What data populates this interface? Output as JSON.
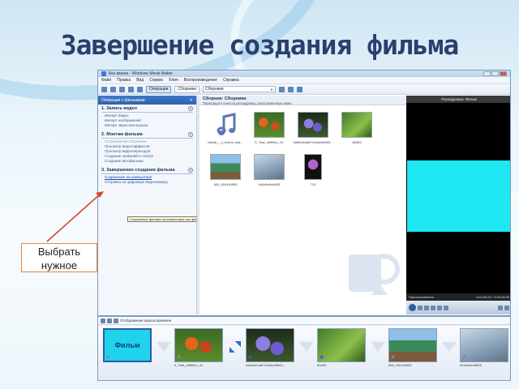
{
  "slide": {
    "title": "Завершение создания фильма",
    "callout": "Выбрать нужное"
  },
  "window": {
    "title": "Без имени - Windows Movie Maker",
    "menu": [
      "Файл",
      "Правка",
      "Вид",
      "Сервис",
      "Клип",
      "Воспроизведение",
      "Справка"
    ],
    "toolbar": {
      "tasks_button": "Операции",
      "collections_button": "Сборники",
      "collection_select": "Сборники"
    }
  },
  "tasks": {
    "header": "Операции с фильмами",
    "sections": [
      {
        "title": "1. Запись видео",
        "links": [
          "Импорт видео",
          "Импорт изображений",
          "Импорт звука или музыки"
        ]
      },
      {
        "title": "2. Монтаж фильма",
        "links": [
          "Отображение сборников",
          "Просмотр видеоэффектов",
          "Просмотр видеопереходов",
          "Создание названий и титров",
          "Создание автофильма"
        ]
      },
      {
        "title": "3. Завершение создания фильма",
        "links": [
          "Сохранение на компьютере",
          "Отправка на цифровую видеокамеру"
        ]
      }
    ],
    "tooltip": "Сохранение фильма на компьютере как файла видео."
  },
  "collection": {
    "title": "Сборник: Сборники",
    "subtitle": "Перетащите клип на раскадровку, расположенную ниже.",
    "items": [
      {
        "caption": "rivka8_-_o_bozhe_kak...",
        "kind": "music"
      },
      {
        "caption": "0_7baf_c6f99ec_XL",
        "kind": "flowers-red"
      },
      {
        "caption": "0a0b0d1afb74184ed9b53...",
        "kind": "flowers-purple"
      },
      {
        "caption": "60453",
        "kind": "green"
      },
      {
        "caption": "600_41b116953",
        "kind": "house"
      },
      {
        "caption": "644a9a1eb625",
        "kind": "sea"
      },
      {
        "caption": "713",
        "kind": "flower-violet"
      }
    ]
  },
  "preview": {
    "header": "Раскадровка: Фильм",
    "status": "Приостановлено",
    "timecode": "0:00:00,00 / 0:00:28,96"
  },
  "storyboard": {
    "bar_label": "Отображение шкалы времени",
    "clips": [
      {
        "caption": "Фильм",
        "title_clip": true
      },
      {
        "caption": "0_7baf_c6f99ec_XL",
        "title_clip": false
      },
      {
        "caption": "0a0b0d1afb74184ed9b53...",
        "title_clip": false
      },
      {
        "caption": "60453",
        "title_clip": false
      },
      {
        "caption": "600_41b116953",
        "title_clip": false
      },
      {
        "caption": "644a9a1eb625",
        "title_clip": false
      }
    ]
  },
  "colors": {
    "title": "#2b3f6e",
    "callout_border": "#e0883a",
    "arrow": "#d9442e",
    "task_header": "#3d79c7",
    "preview_screen": "#1fe7f3"
  }
}
